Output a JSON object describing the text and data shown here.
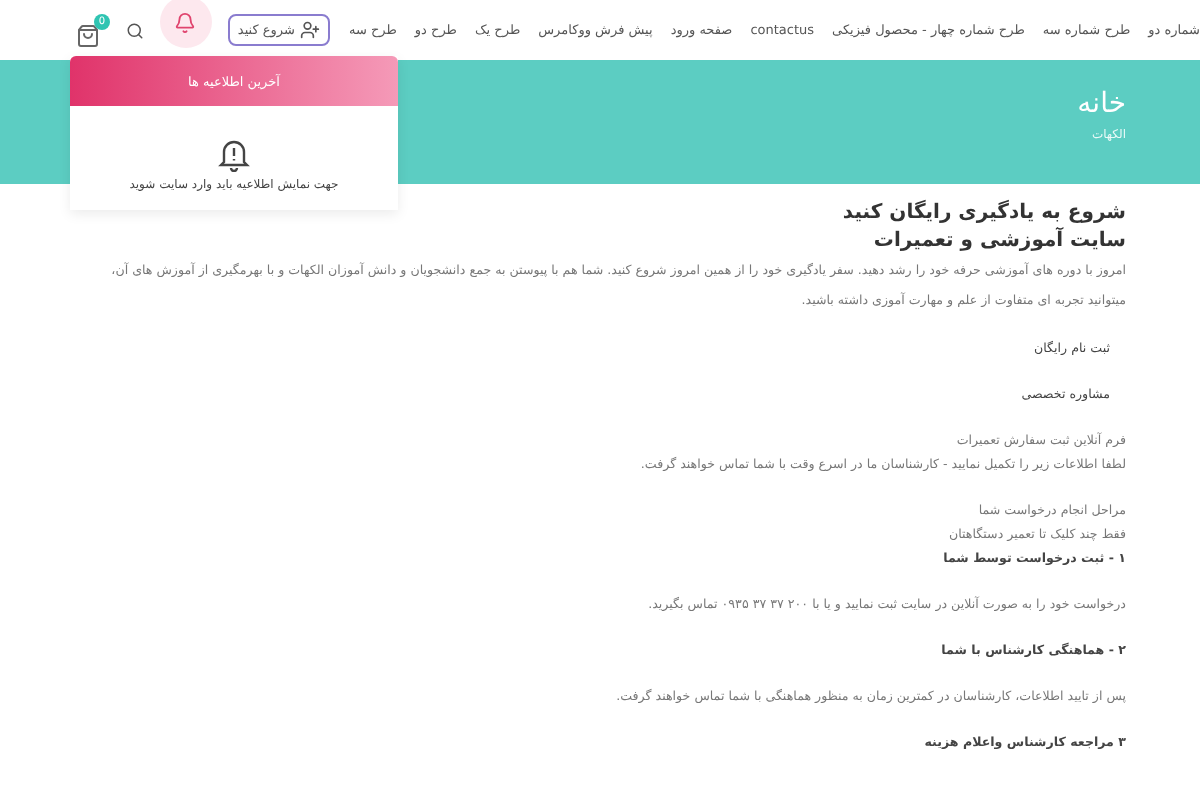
{
  "nav": {
    "items": [
      {
        "label": "شماره دو"
      },
      {
        "label": "طرح شماره سه"
      },
      {
        "label": "طرح شماره چهار - محصول فیزیکی"
      },
      {
        "label": "contactus"
      },
      {
        "label": "صفحه ورود"
      },
      {
        "label": "پیش فرش ووکامرس"
      },
      {
        "label": "طرح یک"
      },
      {
        "label": "طرح دو"
      },
      {
        "label": "طرح سه"
      }
    ],
    "start_button": "شروع کنید",
    "cart_badge": "0"
  },
  "notifications": {
    "title": "آخرین اطلاعیه ها",
    "message": "جهت نمایش اطلاعیه باید وارد سایت شوید"
  },
  "banner": {
    "title": "خانه",
    "breadcrumb": "الکهات"
  },
  "sections": [
    [
      {
        "kind": "title",
        "text": "شروع به یادگیری رایگان کنید"
      },
      {
        "kind": "title",
        "text": "سایت آموزشی و تعمیرات"
      },
      {
        "kind": "lead",
        "text": "امروز با دوره های آموزشی حرفه خود را رشد دهید. سفر یادگیری خود را از همین امروز شروع کنید. شما هم با پیوستن به جمع دانشجویان و دانش آموزان الکهات و با بهرمگیری از آموزش های آن، میتوانید تجربه ای متفاوت از علم و مهارت آموزی داشته باشید."
      }
    ],
    [
      {
        "kind": "label",
        "text": "ثبت نام رایگان"
      }
    ],
    [
      {
        "kind": "label",
        "text": "مشاوره تخصصی"
      }
    ],
    [
      {
        "kind": "text",
        "text": "فرم آنلاین ثبت سفارش تعمیرات"
      },
      {
        "kind": "text",
        "text": "لطفا اطلاعات زیر را تکمیل نمایید - کارشناسان ما در اسرع وقت با شما تماس خواهند گرفت."
      }
    ],
    [
      {
        "kind": "text",
        "text": "مراحل انجام درخواست شما"
      },
      {
        "kind": "text",
        "text": "فقط چند کلیک تا تعمیر دستگاهتان"
      },
      {
        "kind": "step",
        "text": "۱ - ثبت درخواست توسط شما"
      }
    ],
    [
      {
        "kind": "text",
        "text": "درخواست خود را به صورت آنلاین در سایت ثبت نمایید و یا با ۲۰۰ ۳۷ ۳۷ ۰۹۳۵   تماس بگیرید."
      }
    ],
    [
      {
        "kind": "step",
        "text": "۲ - هماهنگی کارشناس با شما"
      }
    ],
    [
      {
        "kind": "text",
        "text": "پس از تایید اطلاعات، کارشناسان در کمترین زمان به منظور هماهنگی با شما تماس خواهند گرفت."
      }
    ],
    [
      {
        "kind": "step",
        "text": "۳ مراجعه کارشناس واعلام هزینه"
      }
    ]
  ]
}
